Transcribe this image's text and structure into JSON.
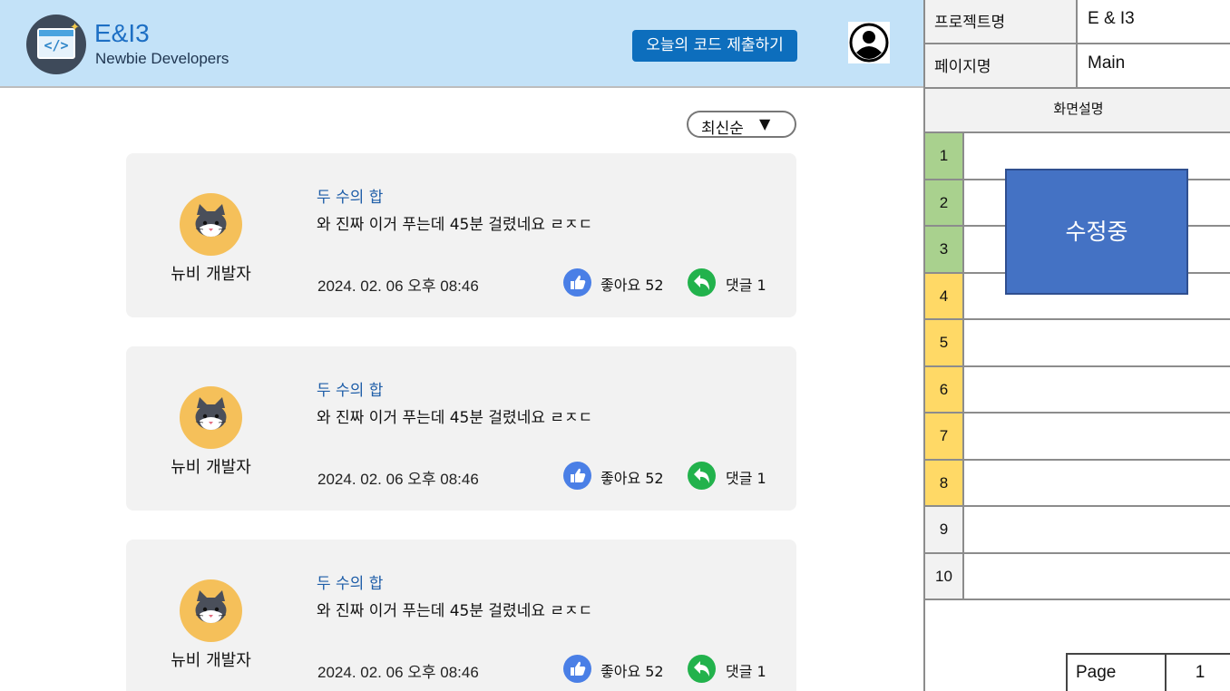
{
  "header": {
    "brand": "E&I3",
    "tagline": "Newbie Developers",
    "submit_label": "오늘의 코드 제출하기",
    "logo_code": "</>"
  },
  "sort": {
    "label": "최신순",
    "arrow": "▼"
  },
  "posts": [
    {
      "author": "뉴비 개발자",
      "title": "두 수의 합",
      "body": "와 진짜 이거 푸는데 45분 걸렸네요 ㄹㅈㄷ",
      "date": "2024. 02. 06 오후 08:46",
      "likes": "좋아요 52",
      "comments": "댓글 1"
    },
    {
      "author": "뉴비 개발자",
      "title": "두 수의 합",
      "body": "와 진짜 이거 푸는데 45분 걸렸네요 ㄹㅈㄷ",
      "date": "2024. 02. 06 오후 08:46",
      "likes": "좋아요 52",
      "comments": "댓글 1"
    },
    {
      "author": "뉴비 개발자",
      "title": "두 수의 합",
      "body": "와 진짜 이거 푸는데 45분 걸렸네요 ㄹㅈㄷ",
      "date": "2024. 02. 06 오후 08:46",
      "likes": "좋아요 52",
      "comments": "댓글 1"
    }
  ],
  "spec": {
    "project_key": "프로젝트명",
    "project_value": "E & I3",
    "page_key": "페이지명",
    "page_value": "Main",
    "description_header": "화면설명",
    "rows": [
      "1",
      "2",
      "3",
      "4",
      "5",
      "6",
      "7",
      "8",
      "9",
      "10"
    ],
    "editing_label": "수정중",
    "page_label": "Page",
    "page_number": "1"
  },
  "colors": {
    "header_bg": "#c3e2f8",
    "primary_button": "#0d6ebd",
    "row_green": "#a9d18e",
    "row_yellow": "#ffd966",
    "row_gray": "#f2f2f2",
    "editing_box": "#4472c4"
  }
}
